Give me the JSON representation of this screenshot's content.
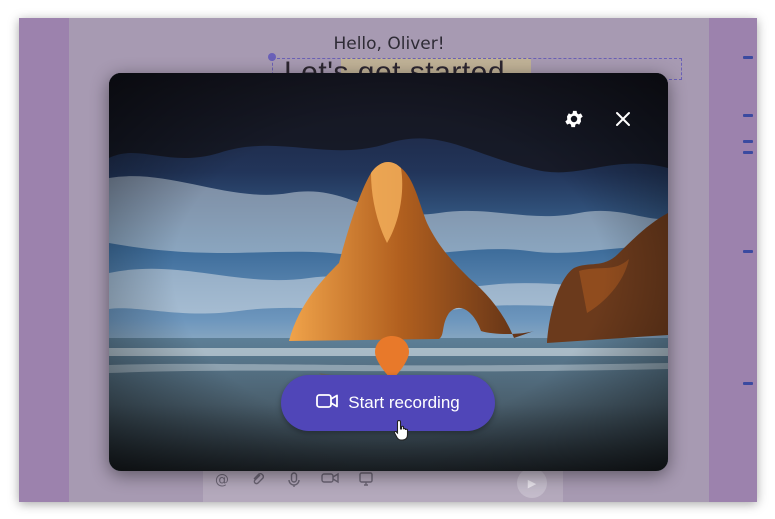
{
  "background_page": {
    "greeting": "Hello, Oliver!",
    "headline": "Let's get started"
  },
  "modal": {
    "settings_icon": "gear-icon",
    "close_icon": "close-icon",
    "record_button": {
      "label": "Start recording",
      "icon": "video-camera-icon",
      "color": "#5046b8"
    },
    "pin_color": "#e8792a"
  },
  "composer": {
    "icons": [
      "at-sign-icon",
      "paperclip-icon",
      "microphone-icon",
      "video-icon",
      "screen-record-icon"
    ],
    "send_icon": "send-icon"
  }
}
